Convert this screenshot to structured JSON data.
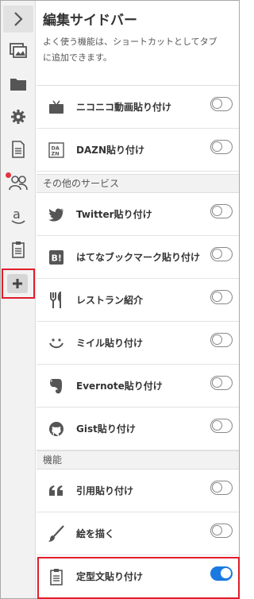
{
  "panel": {
    "title": "編集サイドバー",
    "description_line1": "よく使う機能は、ショートカットとしてタブ",
    "description_line2": "に追加できます。"
  },
  "sidebar_icons": [
    "chevron-right-icon",
    "images-icon",
    "folder-icon",
    "gear-icon",
    "document-icon",
    "users-icon",
    "amazon-icon",
    "clipboard-icon",
    "plus-icon"
  ],
  "items_top": [
    {
      "label": "ニコニコ動画貼り付け",
      "icon": "niconico-tv-icon",
      "enabled": false
    },
    {
      "label": "DAZN貼り付け",
      "icon": "dazn-icon",
      "enabled": false
    }
  ],
  "section_other": {
    "label": "その他のサービス",
    "items": [
      {
        "label": "Twitter貼り付け",
        "icon": "twitter-bird-icon",
        "enabled": false
      },
      {
        "label": "はてなブックマーク貼り付け",
        "icon": "hatena-bookmark-icon",
        "enabled": false
      },
      {
        "label": "レストラン紹介",
        "icon": "fork-knife-icon",
        "enabled": false
      },
      {
        "label": "ミイル貼り付け",
        "icon": "smile-icon",
        "enabled": false
      },
      {
        "label": "Evernote貼り付け",
        "icon": "evernote-icon",
        "enabled": false
      },
      {
        "label": "Gist貼り付け",
        "icon": "github-icon",
        "enabled": false
      }
    ]
  },
  "section_features": {
    "label": "機能",
    "items": [
      {
        "label": "引用貼り付け",
        "icon": "quote-icon",
        "enabled": false
      },
      {
        "label": "絵を描く",
        "icon": "brush-icon",
        "enabled": false
      },
      {
        "label": "定型文貼り付け",
        "icon": "clipboard-icon",
        "enabled": true
      }
    ]
  },
  "colors": {
    "accent": "#1a7ae0",
    "highlight": "#e01e2a",
    "badge": "#e8323c"
  }
}
